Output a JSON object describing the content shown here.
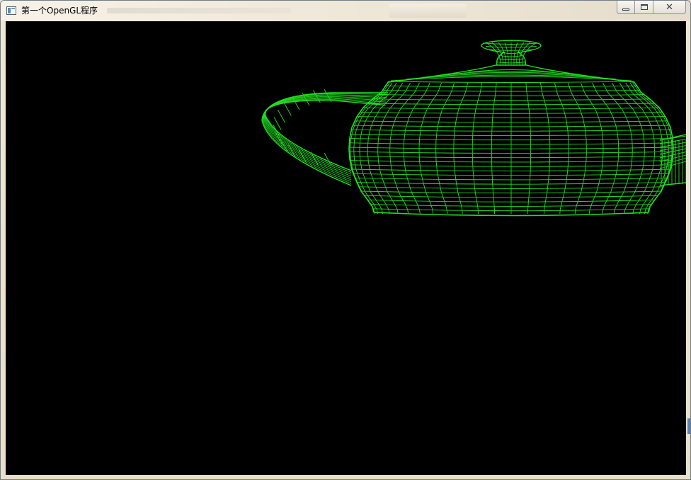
{
  "window": {
    "title": "第一个OpenGL程序",
    "close_glyph": "✕",
    "icons": {
      "app": "application-window-icon",
      "minimize": "minimize-icon",
      "maximize": "maximize-icon",
      "close": "close-icon"
    }
  },
  "scene": {
    "background": "#000000",
    "wire_color": "#1fe01f",
    "model": "teapot-wireframe"
  }
}
